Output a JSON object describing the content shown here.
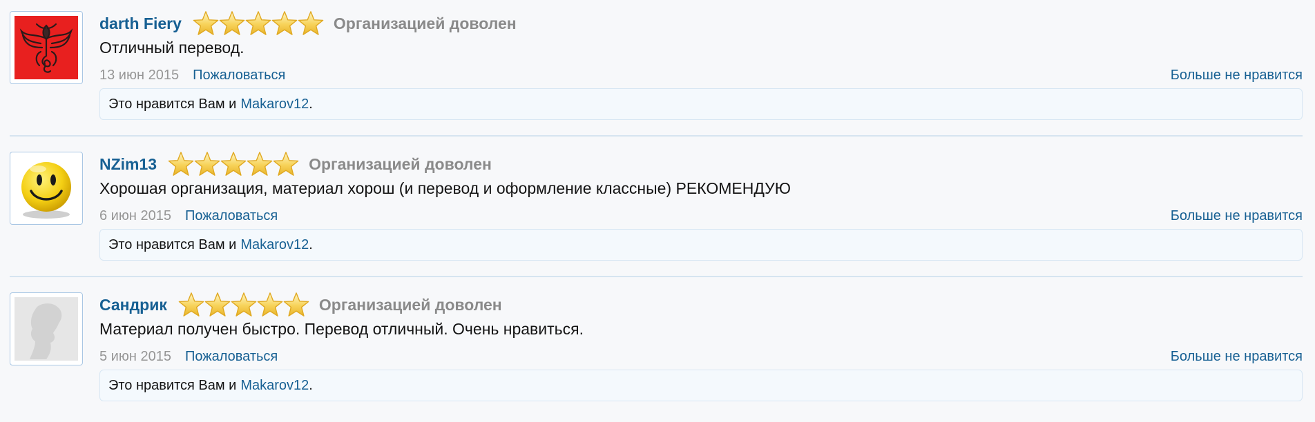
{
  "reviews": [
    {
      "username": "darth Fiery",
      "avatar_icon": "dragon-emblem-avatar",
      "rating": 5,
      "rating_label": "Организацией доволен",
      "text": "Отличный перевод.",
      "date": "13 июн 2015",
      "report_label": "Пожаловаться",
      "unlike_label": "Больше не нравится",
      "likes_prefix": "Это нравится Вам и",
      "liker": "Makarov12",
      "likes_suffix": "."
    },
    {
      "username": "NZim13",
      "avatar_icon": "smiley-face-avatar",
      "rating": 5,
      "rating_label": "Организацией доволен",
      "text": "Хорошая организация, материал хорош (и перевод и оформление классные) РЕКОМЕНДУЮ",
      "date": "6 июн 2015",
      "report_label": "Пожаловаться",
      "unlike_label": "Больше не нравится",
      "likes_prefix": "Это нравится Вам и",
      "liker": "Makarov12",
      "likes_suffix": "."
    },
    {
      "username": "Сандрик",
      "avatar_icon": "default-silhouette-avatar",
      "rating": 5,
      "rating_label": "Организацией доволен",
      "text": "Материал получен быстро. Перевод отличный. Очень нравиться.",
      "date": "5 июн 2015",
      "report_label": "Пожаловаться",
      "unlike_label": "Больше не нравится",
      "likes_prefix": "Это нравится Вам и",
      "liker": "Makarov12",
      "likes_suffix": "."
    }
  ],
  "colors": {
    "link": "#176093",
    "muted": "#8a8a8a",
    "star": "#f3c63a",
    "likes_bg": "#f4f9fd"
  }
}
